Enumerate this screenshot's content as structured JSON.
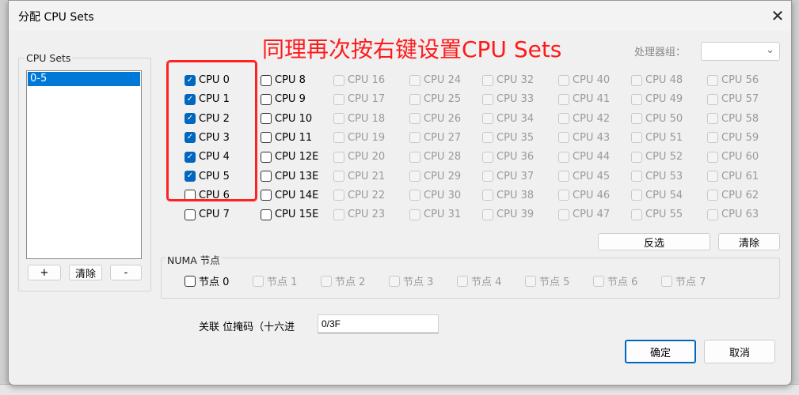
{
  "dialog": {
    "title": "分配 CPU Sets",
    "close_icon": "close-icon"
  },
  "annotation": {
    "text": "同理再次按右键设置CPU Sets",
    "color": "#ff1a1a"
  },
  "cpu_sets": {
    "label": "CPU Sets",
    "items": [
      "0-5"
    ],
    "add": "+",
    "clear": "清除",
    "remove": "-"
  },
  "processor_group": {
    "label": "处理器组：",
    "value": ""
  },
  "cpus": [
    {
      "label": "CPU 0",
      "checked": true,
      "enabled": true
    },
    {
      "label": "CPU 1",
      "checked": true,
      "enabled": true
    },
    {
      "label": "CPU 2",
      "checked": true,
      "enabled": true
    },
    {
      "label": "CPU 3",
      "checked": true,
      "enabled": true
    },
    {
      "label": "CPU 4",
      "checked": true,
      "enabled": true
    },
    {
      "label": "CPU 5",
      "checked": true,
      "enabled": true
    },
    {
      "label": "CPU 6",
      "checked": false,
      "enabled": true
    },
    {
      "label": "CPU 7",
      "checked": false,
      "enabled": true
    },
    {
      "label": "CPU 8",
      "checked": false,
      "enabled": true
    },
    {
      "label": "CPU 9",
      "checked": false,
      "enabled": true
    },
    {
      "label": "CPU 10",
      "checked": false,
      "enabled": true
    },
    {
      "label": "CPU 11",
      "checked": false,
      "enabled": true
    },
    {
      "label": "CPU 12E",
      "checked": false,
      "enabled": true
    },
    {
      "label": "CPU 13E",
      "checked": false,
      "enabled": true
    },
    {
      "label": "CPU 14E",
      "checked": false,
      "enabled": true
    },
    {
      "label": "CPU 15E",
      "checked": false,
      "enabled": true
    },
    {
      "label": "CPU 16",
      "checked": false,
      "enabled": false
    },
    {
      "label": "CPU 17",
      "checked": false,
      "enabled": false
    },
    {
      "label": "CPU 18",
      "checked": false,
      "enabled": false
    },
    {
      "label": "CPU 19",
      "checked": false,
      "enabled": false
    },
    {
      "label": "CPU 20",
      "checked": false,
      "enabled": false
    },
    {
      "label": "CPU 21",
      "checked": false,
      "enabled": false
    },
    {
      "label": "CPU 22",
      "checked": false,
      "enabled": false
    },
    {
      "label": "CPU 23",
      "checked": false,
      "enabled": false
    },
    {
      "label": "CPU 24",
      "checked": false,
      "enabled": false
    },
    {
      "label": "CPU 25",
      "checked": false,
      "enabled": false
    },
    {
      "label": "CPU 26",
      "checked": false,
      "enabled": false
    },
    {
      "label": "CPU 27",
      "checked": false,
      "enabled": false
    },
    {
      "label": "CPU 28",
      "checked": false,
      "enabled": false
    },
    {
      "label": "CPU 29",
      "checked": false,
      "enabled": false
    },
    {
      "label": "CPU 30",
      "checked": false,
      "enabled": false
    },
    {
      "label": "CPU 31",
      "checked": false,
      "enabled": false
    },
    {
      "label": "CPU 32",
      "checked": false,
      "enabled": false
    },
    {
      "label": "CPU 33",
      "checked": false,
      "enabled": false
    },
    {
      "label": "CPU 34",
      "checked": false,
      "enabled": false
    },
    {
      "label": "CPU 35",
      "checked": false,
      "enabled": false
    },
    {
      "label": "CPU 36",
      "checked": false,
      "enabled": false
    },
    {
      "label": "CPU 37",
      "checked": false,
      "enabled": false
    },
    {
      "label": "CPU 38",
      "checked": false,
      "enabled": false
    },
    {
      "label": "CPU 39",
      "checked": false,
      "enabled": false
    },
    {
      "label": "CPU 40",
      "checked": false,
      "enabled": false
    },
    {
      "label": "CPU 41",
      "checked": false,
      "enabled": false
    },
    {
      "label": "CPU 42",
      "checked": false,
      "enabled": false
    },
    {
      "label": "CPU 43",
      "checked": false,
      "enabled": false
    },
    {
      "label": "CPU 44",
      "checked": false,
      "enabled": false
    },
    {
      "label": "CPU 45",
      "checked": false,
      "enabled": false
    },
    {
      "label": "CPU 46",
      "checked": false,
      "enabled": false
    },
    {
      "label": "CPU 47",
      "checked": false,
      "enabled": false
    },
    {
      "label": "CPU 48",
      "checked": false,
      "enabled": false
    },
    {
      "label": "CPU 49",
      "checked": false,
      "enabled": false
    },
    {
      "label": "CPU 50",
      "checked": false,
      "enabled": false
    },
    {
      "label": "CPU 51",
      "checked": false,
      "enabled": false
    },
    {
      "label": "CPU 52",
      "checked": false,
      "enabled": false
    },
    {
      "label": "CPU 53",
      "checked": false,
      "enabled": false
    },
    {
      "label": "CPU 54",
      "checked": false,
      "enabled": false
    },
    {
      "label": "CPU 55",
      "checked": false,
      "enabled": false
    },
    {
      "label": "CPU 56",
      "checked": false,
      "enabled": false
    },
    {
      "label": "CPU 57",
      "checked": false,
      "enabled": false
    },
    {
      "label": "CPU 58",
      "checked": false,
      "enabled": false
    },
    {
      "label": "CPU 59",
      "checked": false,
      "enabled": false
    },
    {
      "label": "CPU 60",
      "checked": false,
      "enabled": false
    },
    {
      "label": "CPU 61",
      "checked": false,
      "enabled": false
    },
    {
      "label": "CPU 62",
      "checked": false,
      "enabled": false
    },
    {
      "label": "CPU 63",
      "checked": false,
      "enabled": false
    }
  ],
  "cpu_buttons": {
    "invert": "反选",
    "clear": "清除"
  },
  "numa": {
    "label": "NUMA 节点",
    "nodes": [
      {
        "label": "节点 0",
        "enabled": true
      },
      {
        "label": "节点 1",
        "enabled": false
      },
      {
        "label": "节点 2",
        "enabled": false
      },
      {
        "label": "节点 3",
        "enabled": false
      },
      {
        "label": "节点 4",
        "enabled": false
      },
      {
        "label": "节点 5",
        "enabled": false
      },
      {
        "label": "节点 6",
        "enabled": false
      },
      {
        "label": "节点 7",
        "enabled": false
      }
    ]
  },
  "mask": {
    "label": "关联 位掩码（十六进",
    "value": "0/3F"
  },
  "footer": {
    "ok": "确定",
    "cancel": "取消"
  }
}
